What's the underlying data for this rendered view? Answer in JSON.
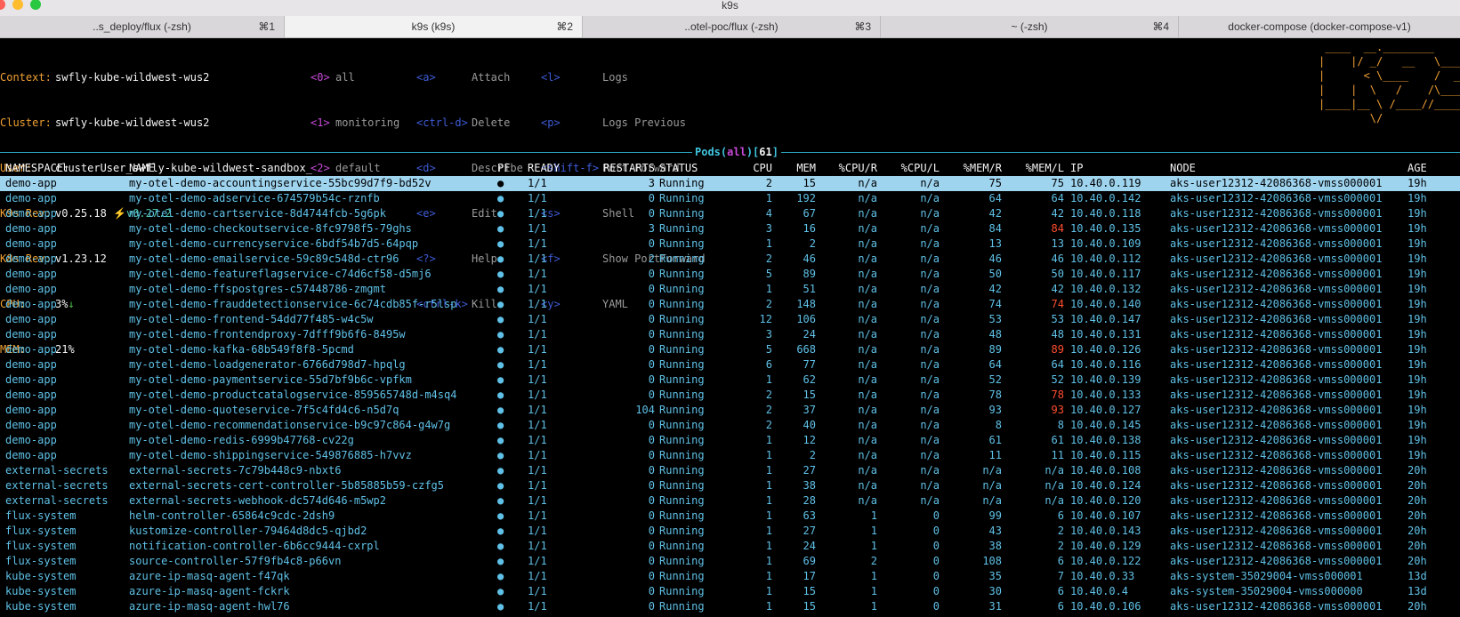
{
  "window": {
    "title": "k9s",
    "tabs": [
      {
        "label": "..s_deploy/flux (-zsh)",
        "shortcut": "⌘1",
        "active": false
      },
      {
        "label": "k9s (k9s)",
        "shortcut": "⌘2",
        "active": true
      },
      {
        "label": "..otel-poc/flux (-zsh)",
        "shortcut": "⌘3",
        "active": false
      },
      {
        "label": "~ (-zsh)",
        "shortcut": "⌘4",
        "active": false
      },
      {
        "label": "docker-compose (docker-compose-v1)",
        "shortcut": "",
        "active": false
      }
    ]
  },
  "cluster_info": {
    "context_label": "Context:",
    "context": "swfly-kube-wildwest-wus2",
    "cluster_label": "Cluster:",
    "cluster": "swfly-kube-wildwest-wus2",
    "user_label": "User:",
    "user": "clusterUser_swfly-kube-wildwest-sandbox_",
    "k9s_rev_label": "K9s Rev:",
    "k9s_rev": "v0.25.18",
    "k9s_rev_new": "⚡️v0.27.2",
    "k8s_rev_label": "K8s Rev:",
    "k8s_rev": "v1.23.12",
    "cpu_label": "CPU:",
    "cpu": "3%",
    "cpu_trend": "↓",
    "mem_label": "MEM:",
    "mem": "21%"
  },
  "namespaces": [
    {
      "key": "<0>",
      "name": "all"
    },
    {
      "key": "<1>",
      "name": "monitoring"
    },
    {
      "key": "<2>",
      "name": "default"
    }
  ],
  "shortcuts_col1": [
    {
      "key": "<a>",
      "label": "Attach"
    },
    {
      "key": "<ctrl-d>",
      "label": "Delete"
    },
    {
      "key": "<d>",
      "label": "Describe"
    },
    {
      "key": "<e>",
      "label": "Edit"
    },
    {
      "key": "<?>",
      "label": "Help"
    },
    {
      "key": "<ctrl-k>",
      "label": "Kill"
    }
  ],
  "shortcuts_col2": [
    {
      "key": "<l>",
      "label": "Logs"
    },
    {
      "key": "<p>",
      "label": "Logs Previous"
    },
    {
      "key": "<shift-f>",
      "label": "Port-Forward"
    },
    {
      "key": "<s>",
      "label": "Shell"
    },
    {
      "key": "<f>",
      "label": "Show PortForward"
    },
    {
      "key": "<y>",
      "label": "YAML"
    }
  ],
  "logo_lines": [
    " ____  __.________",
    "|    |/ _/   __   \\______",
    "|      < \\____    /  ___/",
    "|    |  \\   /    /\\___ \\",
    "|____|__ \\ /____//____  >",
    "        \\/            \\/"
  ],
  "view": {
    "resource": "Pods",
    "filter": "all",
    "count": "61"
  },
  "table": {
    "columns": {
      "namespace": "NAMESPACE↑",
      "name": "NAME",
      "pf": "PF",
      "ready": "READY",
      "restarts": "RESTARTS",
      "status": "STATUS",
      "cpu": "CPU",
      "mem": "MEM",
      "cpu_r": "%CPU/R",
      "cpu_l": "%CPU/L",
      "mem_r": "%MEM/R",
      "mem_l": "%MEM/L",
      "ip": "IP",
      "node": "NODE",
      "age": "AGE"
    },
    "rows": [
      [
        "demo-app",
        "my-otel-demo-accountingservice-55bc99d7f9-bd52v",
        "●",
        "1/1",
        "3",
        "Running",
        "2",
        "15",
        "n/a",
        "n/a",
        "75",
        "75",
        "10.40.0.119",
        "aks-user12312-42086368-vmss000001",
        "19h"
      ],
      [
        "demo-app",
        "my-otel-demo-adservice-674579b54c-rznfb",
        "●",
        "1/1",
        "0",
        "Running",
        "1",
        "192",
        "n/a",
        "n/a",
        "64",
        "64",
        "10.40.0.142",
        "aks-user12312-42086368-vmss000001",
        "19h"
      ],
      [
        "demo-app",
        "my-otel-demo-cartservice-8d4744fcb-5g6pk",
        "●",
        "1/1",
        "0",
        "Running",
        "4",
        "67",
        "n/a",
        "n/a",
        "42",
        "42",
        "10.40.0.118",
        "aks-user12312-42086368-vmss000001",
        "19h"
      ],
      [
        "demo-app",
        "my-otel-demo-checkoutservice-8fc9798f5-79ghs",
        "●",
        "1/1",
        "3",
        "Running",
        "3",
        "16",
        "n/a",
        "n/a",
        "84",
        "84",
        "10.40.0.135",
        "aks-user12312-42086368-vmss000001",
        "19h"
      ],
      [
        "demo-app",
        "my-otel-demo-currencyservice-6bdf54b7d5-64pqp",
        "●",
        "1/1",
        "0",
        "Running",
        "1",
        "2",
        "n/a",
        "n/a",
        "13",
        "13",
        "10.40.0.109",
        "aks-user12312-42086368-vmss000001",
        "19h"
      ],
      [
        "demo-app",
        "my-otel-demo-emailservice-59c89c548d-ctr96",
        "●",
        "1/1",
        "2",
        "Running",
        "2",
        "46",
        "n/a",
        "n/a",
        "46",
        "46",
        "10.40.0.112",
        "aks-user12312-42086368-vmss000001",
        "19h"
      ],
      [
        "demo-app",
        "my-otel-demo-featureflagservice-c74d6cf58-d5mj6",
        "●",
        "1/1",
        "0",
        "Running",
        "5",
        "89",
        "n/a",
        "n/a",
        "50",
        "50",
        "10.40.0.117",
        "aks-user12312-42086368-vmss000001",
        "19h"
      ],
      [
        "demo-app",
        "my-otel-demo-ffspostgres-c57448786-zmgmt",
        "●",
        "1/1",
        "0",
        "Running",
        "1",
        "51",
        "n/a",
        "n/a",
        "42",
        "42",
        "10.40.0.132",
        "aks-user12312-42086368-vmss000001",
        "19h"
      ],
      [
        "demo-app",
        "my-otel-demo-frauddetectionservice-6c74cdb85f-r5lsp",
        "●",
        "1/1",
        "0",
        "Running",
        "2",
        "148",
        "n/a",
        "n/a",
        "74",
        "74",
        "10.40.0.140",
        "aks-user12312-42086368-vmss000001",
        "19h"
      ],
      [
        "demo-app",
        "my-otel-demo-frontend-54dd77f485-w4c5w",
        "●",
        "1/1",
        "0",
        "Running",
        "12",
        "106",
        "n/a",
        "n/a",
        "53",
        "53",
        "10.40.0.147",
        "aks-user12312-42086368-vmss000001",
        "19h"
      ],
      [
        "demo-app",
        "my-otel-demo-frontendproxy-7dfff9b6f6-8495w",
        "●",
        "1/1",
        "0",
        "Running",
        "3",
        "24",
        "n/a",
        "n/a",
        "48",
        "48",
        "10.40.0.131",
        "aks-user12312-42086368-vmss000001",
        "19h"
      ],
      [
        "demo-app",
        "my-otel-demo-kafka-68b549f8f8-5pcmd",
        "●",
        "1/1",
        "0",
        "Running",
        "5",
        "668",
        "n/a",
        "n/a",
        "89",
        "89",
        "10.40.0.126",
        "aks-user12312-42086368-vmss000001",
        "19h"
      ],
      [
        "demo-app",
        "my-otel-demo-loadgenerator-6766d798d7-hpqlg",
        "●",
        "1/1",
        "0",
        "Running",
        "6",
        "77",
        "n/a",
        "n/a",
        "64",
        "64",
        "10.40.0.116",
        "aks-user12312-42086368-vmss000001",
        "19h"
      ],
      [
        "demo-app",
        "my-otel-demo-paymentservice-55d7bf9b6c-vpfkm",
        "●",
        "1/1",
        "0",
        "Running",
        "1",
        "62",
        "n/a",
        "n/a",
        "52",
        "52",
        "10.40.0.139",
        "aks-user12312-42086368-vmss000001",
        "19h"
      ],
      [
        "demo-app",
        "my-otel-demo-productcatalogservice-859565748d-m4sq4",
        "●",
        "1/1",
        "0",
        "Running",
        "2",
        "15",
        "n/a",
        "n/a",
        "78",
        "78",
        "10.40.0.133",
        "aks-user12312-42086368-vmss000001",
        "19h"
      ],
      [
        "demo-app",
        "my-otel-demo-quoteservice-7f5c4fd4c6-n5d7q",
        "●",
        "1/1",
        "104",
        "Running",
        "2",
        "37",
        "n/a",
        "n/a",
        "93",
        "93",
        "10.40.0.127",
        "aks-user12312-42086368-vmss000001",
        "19h"
      ],
      [
        "demo-app",
        "my-otel-demo-recommendationservice-b9c97c864-g4w7g",
        "●",
        "1/1",
        "0",
        "Running",
        "2",
        "40",
        "n/a",
        "n/a",
        "8",
        "8",
        "10.40.0.145",
        "aks-user12312-42086368-vmss000001",
        "19h"
      ],
      [
        "demo-app",
        "my-otel-demo-redis-6999b47768-cv22g",
        "●",
        "1/1",
        "0",
        "Running",
        "1",
        "12",
        "n/a",
        "n/a",
        "61",
        "61",
        "10.40.0.138",
        "aks-user12312-42086368-vmss000001",
        "19h"
      ],
      [
        "demo-app",
        "my-otel-demo-shippingservice-549876885-h7vvz",
        "●",
        "1/1",
        "0",
        "Running",
        "1",
        "2",
        "n/a",
        "n/a",
        "11",
        "11",
        "10.40.0.115",
        "aks-user12312-42086368-vmss000001",
        "19h"
      ],
      [
        "external-secrets",
        "external-secrets-7c79b448c9-nbxt6",
        "●",
        "1/1",
        "0",
        "Running",
        "1",
        "27",
        "n/a",
        "n/a",
        "n/a",
        "n/a",
        "10.40.0.108",
        "aks-user12312-42086368-vmss000001",
        "20h"
      ],
      [
        "external-secrets",
        "external-secrets-cert-controller-5b85885b59-czfg5",
        "●",
        "1/1",
        "0",
        "Running",
        "1",
        "38",
        "n/a",
        "n/a",
        "n/a",
        "n/a",
        "10.40.0.124",
        "aks-user12312-42086368-vmss000001",
        "20h"
      ],
      [
        "external-secrets",
        "external-secrets-webhook-dc574d646-m5wp2",
        "●",
        "1/1",
        "0",
        "Running",
        "1",
        "28",
        "n/a",
        "n/a",
        "n/a",
        "n/a",
        "10.40.0.120",
        "aks-user12312-42086368-vmss000001",
        "20h"
      ],
      [
        "flux-system",
        "helm-controller-65864c9cdc-2dsh9",
        "●",
        "1/1",
        "0",
        "Running",
        "1",
        "63",
        "1",
        "0",
        "99",
        "6",
        "10.40.0.107",
        "aks-user12312-42086368-vmss000001",
        "20h"
      ],
      [
        "flux-system",
        "kustomize-controller-79464d8dc5-qjbd2",
        "●",
        "1/1",
        "0",
        "Running",
        "1",
        "27",
        "1",
        "0",
        "43",
        "2",
        "10.40.0.143",
        "aks-user12312-42086368-vmss000001",
        "20h"
      ],
      [
        "flux-system",
        "notification-controller-6b6cc9444-cxrpl",
        "●",
        "1/1",
        "0",
        "Running",
        "1",
        "24",
        "1",
        "0",
        "38",
        "2",
        "10.40.0.129",
        "aks-user12312-42086368-vmss000001",
        "20h"
      ],
      [
        "flux-system",
        "source-controller-57f9fb4c8-p66vn",
        "●",
        "1/1",
        "0",
        "Running",
        "1",
        "69",
        "2",
        "0",
        "108",
        "6",
        "10.40.0.122",
        "aks-user12312-42086368-vmss000001",
        "20h"
      ],
      [
        "kube-system",
        "azure-ip-masq-agent-f47qk",
        "●",
        "1/1",
        "0",
        "Running",
        "1",
        "17",
        "1",
        "0",
        "35",
        "7",
        "10.40.0.33",
        "aks-system-35029004-vmss000001",
        "13d"
      ],
      [
        "kube-system",
        "azure-ip-masq-agent-fckrk",
        "●",
        "1/1",
        "0",
        "Running",
        "1",
        "15",
        "1",
        "0",
        "30",
        "6",
        "10.40.0.4",
        "aks-system-35029004-vmss000000",
        "13d"
      ],
      [
        "kube-system",
        "azure-ip-masq-agent-hwl76",
        "●",
        "1/1",
        "0",
        "Running",
        "1",
        "15",
        "1",
        "0",
        "31",
        "6",
        "10.40.0.106",
        "aks-user12312-42086368-vmss000001",
        "20h"
      ]
    ],
    "hot_mem_l_rows": [
      3,
      8,
      11,
      14,
      15
    ]
  },
  "colors": {
    "background": "#000000",
    "row_text": "#5fc1e7",
    "selected_row": "#9fd4ef",
    "header_key": "#f0a033",
    "namespace_key": "#c74ad8",
    "shortcut_key": "#3e5bd6",
    "hot_value": "#ff4d2e"
  }
}
